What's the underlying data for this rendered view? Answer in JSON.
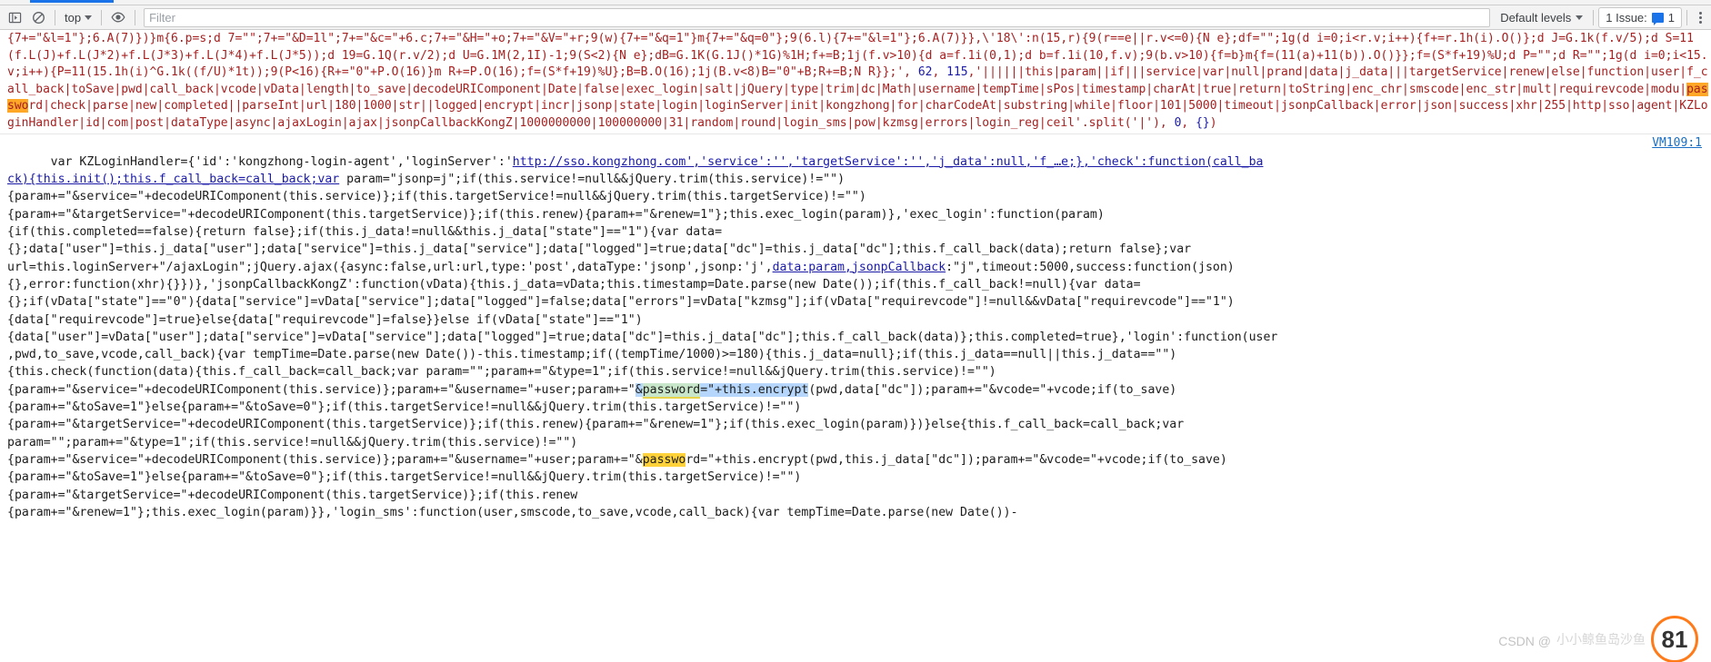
{
  "toolbar": {
    "sidebar_toggle_title": "Show console sidebar",
    "clear_console_title": "Clear console",
    "context_label": "top",
    "eye_title": "Create live expression",
    "filter_placeholder": "Filter",
    "filter_value": "",
    "levels_label": "Default levels",
    "issues_label": "1 Issue:",
    "issues_count": "1",
    "more_options_title": "Console settings",
    "accent_color": "#1a73e8"
  },
  "console": {
    "vm_link": "VM109:1",
    "minified": {
      "line1": "{7+=\"&l=1\"};6.A(7)})}m{6.p=s;d 7=\"\";7+=\"&D=1l\";7+=\"&c=\"+6.c;7+=\"&H=\"+o;7+=\"&V=\"+r;9(w){7+=\"&q=1\"}m{7+=\"&q=0\"};9(6.l){7+=\"&l=1\"};6.A(7)}},\\'18\\':n(15,r){9(r==e||r.v<=0){N e};d",
      "line2": "f=\"\";1g(d i=0;i<r.v;i++){f+=r.1h(i).O()};d J=G.1k(f.v/5);d S=11(f.L(J)+f.L(J*2)+f.L(J*3)+f.L(J*4)+f.L(J*5));d 19=G.1Q(r.v/2);d U=G.1M(2,1I)-1;9(S<2){N e};d",
      "line3": "B=G.1K(G.1J()*1G)%1H;f+=B;1j(f.v>10){d a=f.1i(0,1);d b=f.1i(10,f.v);9(b.v>10){f=b}m{f=(11(a)+11(b)).O()}};f=(S*f+19)%U;d P=\"\";d R=\"\";1g(d i=0;i<15.v;i++)",
      "line4_a": "{P=11(15.1h(i)^G.1k((f/U)*1t));9(P<16){R+=\"0\"+P.O(16)}m R+=P.O(16);f=(S*f+19)%U};B=B.O(16);1j(B.v<8)B=\"0\"+B;R+=B;N R}};', ",
      "line4_num1": "62",
      "line4_sep": ", ",
      "line4_num2": "115",
      "line4_end": ",",
      "line5": "'||||||this|param||if|||service|var|null|prand|data|j_data|||targetService|renew|else|function|user|f_call_back|toSave|pwd|call_back|vcode|vData|length|to_save|decodeURIComponen",
      "line6_a": "t|Date|false|exec_login|salt|jQuery|type|trim|dc|Math|username|tempTime|sPos|timestamp|charAt|true|return|toString|enc_chr|smscode|enc_str|mult|requirevcode|modu|",
      "line6_hl": "passwo",
      "line6_b": "rd|check|",
      "line7": "parse|new|completed||parseInt|url|180|1000|str||logged|encrypt|incr|jsonp|state|login|loginServer|init|kongzhong|for|charCodeAt|substring|while|floor|101|5000|timeout|jsonpCallb",
      "line8": "ack|error|json|success|xhr|255|http|sso|agent|KZLoginHandler|id|com|post|dataType|async|ajaxLogin|ajax|jsonpCallbackKongZ|1000000000|100000000|31|random|round|login_sms|pow|kzms",
      "line9_a": "g|errors|login_reg|ceil'.split('|'), ",
      "line9_num1": "0",
      "line9_sep": ", ",
      "line9_num2": "{}",
      "line9_end": ")"
    },
    "code": {
      "l1_a": "var KZLoginHandler={'id':'kongzhong-login-agent','loginServer':'",
      "l1_url": "http://sso.kongzhong.com','service':'','targetService':'','j_data':null,'f_…e;},'check':function(call_ba",
      "l2_link": "ck){this.init();this.f_call_back=call_back;var",
      "l2_rest": " param=\"jsonp=j\";if(this.service!=null&&jQuery.trim(this.service)!=\"\")",
      "l3": "{param+=\"&service=\"+decodeURIComponent(this.service)};if(this.targetService!=null&&jQuery.trim(this.targetService)!=\"\")",
      "l4": "{param+=\"&targetService=\"+decodeURIComponent(this.targetService)};if(this.renew){param+=\"&renew=1\"};this.exec_login(param)},'exec_login':function(param)",
      "l5": "{if(this.completed==false){return false};if(this.j_data!=null&&this.j_data[\"state\"]==\"1\"){var data=",
      "l6": "{};data[\"user\"]=this.j_data[\"user\"];data[\"service\"]=this.j_data[\"service\"];data[\"logged\"]=true;data[\"dc\"]=this.j_data[\"dc\"];this.f_call_back(data);return false};var",
      "l7": "url=this.loginServer+\"/ajaxLogin\";jQuery.ajax({async:false,url:url,type:'post',dataType:'jsonp',jsonp:'j',",
      "l7_link": "data:param,jsonpCallback",
      "l7_rest": ":\"j\",timeout:5000,success:function(json)",
      "l8": "{},error:function(xhr){}})},'jsonpCallbackKongZ':function(vData){this.j_data=vData;this.timestamp=Date.parse(new Date());if(this.f_call_back!=null){var data=",
      "l9": "{};if(vData[\"state\"]==\"0\"){data[\"service\"]=vData[\"service\"];data[\"logged\"]=false;data[\"errors\"]=vData[\"kzmsg\"];if(vData[\"requirevcode\"]!=null&&vData[\"requirevcode\"]==\"1\")",
      "l10": "{data[\"requirevcode\"]=true}else{data[\"requirevcode\"]=false}}else if(vData[\"state\"]==\"1\")",
      "l11": "{data[\"user\"]=vData[\"user\"];data[\"service\"]=vData[\"service\"];data[\"logged\"]=true;data[\"dc\"]=this.j_data[\"dc\"];this.f_call_back(data)};this.completed=true},'login':function(user",
      "l12": ",pwd,to_save,vcode,call_back){var tempTime=Date.parse(new Date())-this.timestamp;if((tempTime/1000)>=180){this.j_data=null};if(this.j_data==null||this.j_data==\"\")",
      "l13": "{this.check(function(data){this.f_call_back=call_back;var param=\"\";param+=\"&type=1\";if(this.service!=null&&jQuery.trim(this.service)!=\"\")",
      "l14_a": "{param+=\"&service=\"+decodeURIComponent(this.service)};param+=\"&username=\"+user;param+=\"",
      "l14_hl_sel": "&",
      "l14_hl_pass": "password",
      "l14_b": "=\"+this.encrypt",
      "l14_c": "(pwd,data[\"dc\"]);param+=\"&vcode=\"+vcode;if(to_save)",
      "l15": "{param+=\"&toSave=1\"}else{param+=\"&toSave=0\"};if(this.targetService!=null&&jQuery.trim(this.targetService)!=\"\")",
      "l16": "{param+=\"&targetService=\"+decodeURIComponent(this.targetService)};if(this.renew){param+=\"&renew=1\"};if(this.exec_login(param)})}else{this.f_call_back=call_back;var",
      "l17": "param=\"\";param+=\"&type=1\";if(this.service!=null&&jQuery.trim(this.service)!=\"\")",
      "l18_a": "{param+=\"&service=\"+decodeURIComponent(this.service)};param+=\"&username=\"+user;param+=\"&",
      "l18_hl": "passwo",
      "l18_b": "rd=\"+this.encrypt(pwd,this.j_data[\"dc\"]);param+=\"&vcode=\"+vcode;if(to_save)",
      "l19": "{param+=\"&toSave=1\"}else{param+=\"&toSave=0\"};if(this.targetService!=null&&jQuery.trim(this.targetService)!=\"\")",
      "l20": "{param+=\"&targetService=\"+decodeURIComponent(this.targetService)};if(this.renew",
      "l21": "{param+=\"&renew=1\"};this.exec_login(param)}},'login_sms':function(user,smscode,to_save,vcode,call_back){var tempTime=Date.parse(new Date())-"
    }
  },
  "watermark": {
    "text": "CSDN @",
    "cn_text": "小小鲸鱼岛沙鱼",
    "badge": "81"
  }
}
